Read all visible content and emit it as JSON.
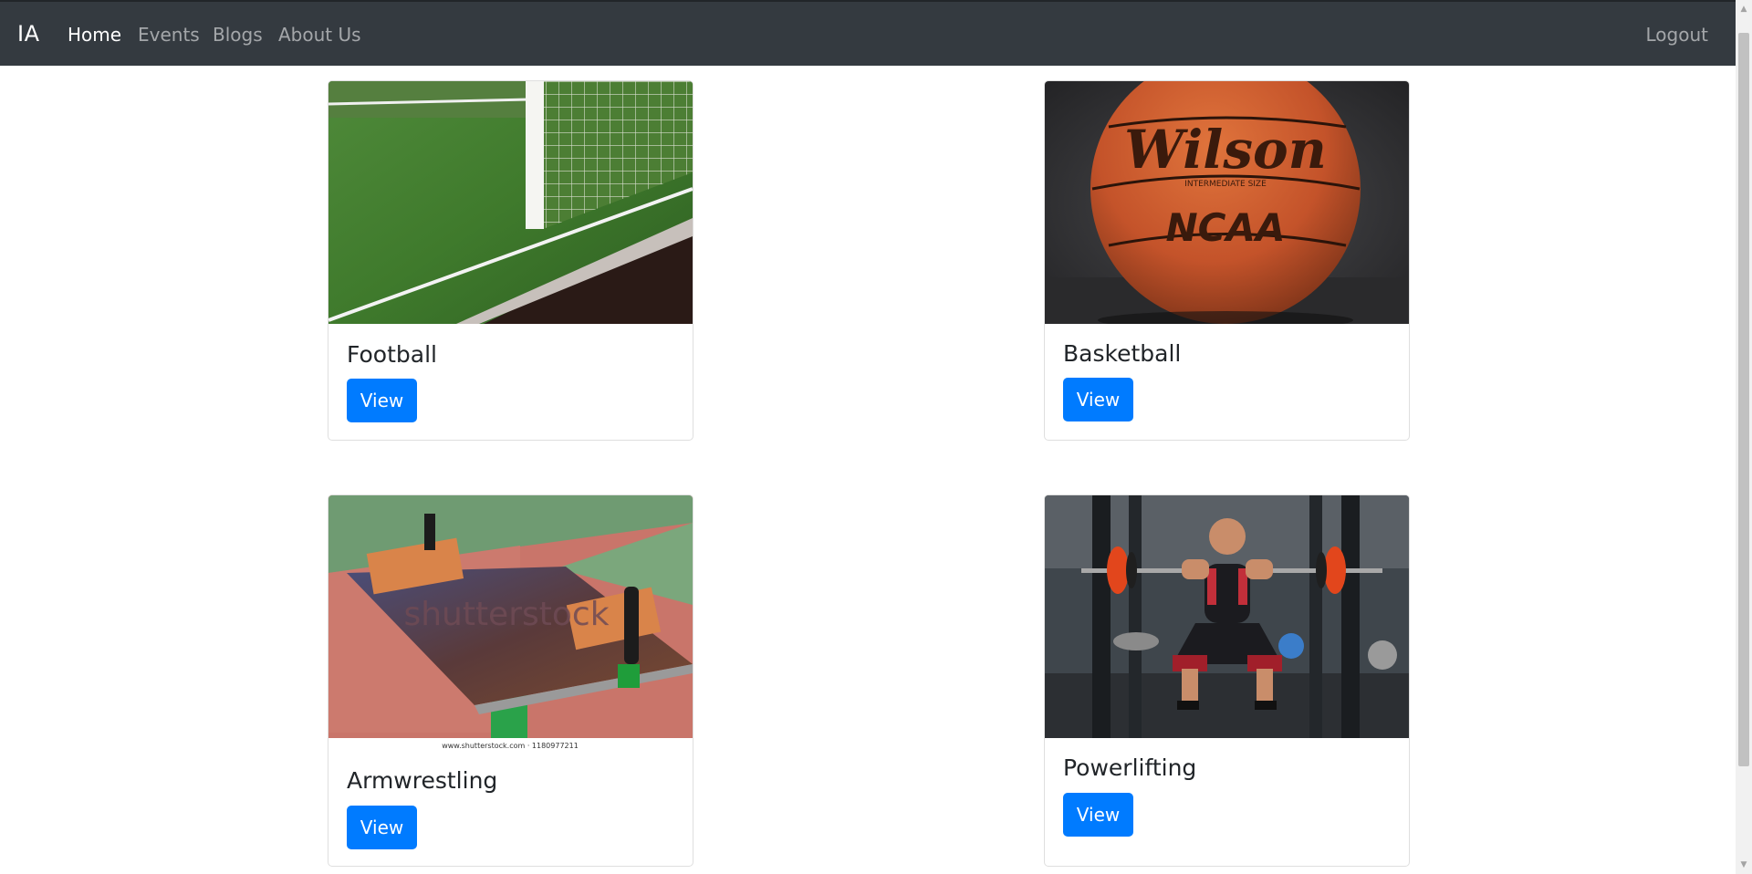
{
  "navbar": {
    "brand": "IA",
    "links": [
      {
        "label": "Home",
        "active": true
      },
      {
        "label": "Events",
        "active": false
      },
      {
        "label": "Blogs",
        "active": false
      },
      {
        "label": "About Us",
        "active": false
      }
    ],
    "logout_label": "Logout"
  },
  "cards": [
    {
      "title": "Football",
      "button_label": "View",
      "image": "football-goal-net-photo"
    },
    {
      "title": "Basketball",
      "button_label": "View",
      "image": "wilson-ncaa-basketball-photo"
    },
    {
      "title": "Armwrestling",
      "button_label": "View",
      "image": "armwrestling-table-photo",
      "image_watermark": "shutterstock",
      "image_caption": "www.shutterstock.com · 1180977211"
    },
    {
      "title": "Powerlifting",
      "button_label": "View",
      "image": "powerlifting-squat-photo"
    }
  ],
  "colors": {
    "navbar_bg": "#343a40",
    "primary_button": "#007bff",
    "nav_active": "#ffffff",
    "nav_inactive": "rgba(255,255,255,0.55)"
  }
}
